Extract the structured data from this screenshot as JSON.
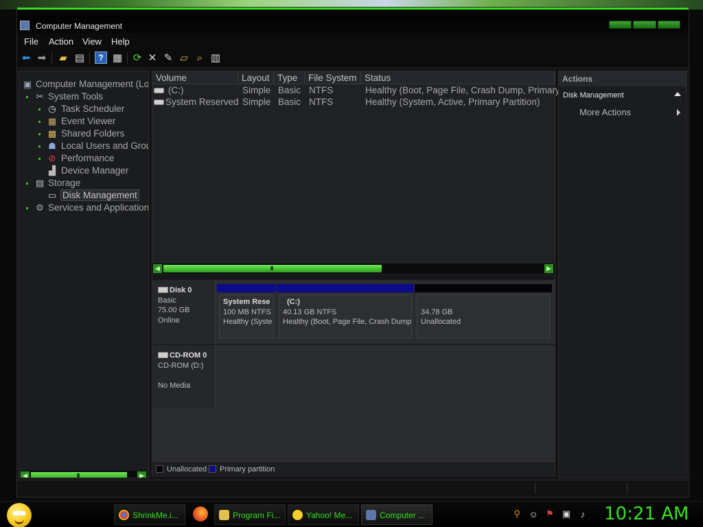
{
  "window": {
    "title": "Computer Management"
  },
  "menu": [
    "File",
    "Action",
    "View",
    "Help"
  ],
  "toolbar": {
    "icons": [
      "back-icon",
      "forward-icon",
      "up-folder-icon",
      "show-hide-tree-icon",
      "help-icon",
      "properties-icon",
      "refresh-icon",
      "delete-icon",
      "rescan-icon",
      "open-icon",
      "explore-icon",
      "properties-list-icon"
    ]
  },
  "tree": {
    "items": [
      {
        "label": "Computer Management (Loc",
        "icon": "computer-icon"
      },
      {
        "label": "System Tools",
        "icon": "tools-icon"
      },
      {
        "label": "Task Scheduler",
        "icon": "clock-icon"
      },
      {
        "label": "Event Viewer",
        "icon": "event-viewer-icon"
      },
      {
        "label": "Shared Folders",
        "icon": "shared-folder-icon"
      },
      {
        "label": "Local Users and Grou",
        "icon": "users-icon"
      },
      {
        "label": "Performance",
        "icon": "performance-icon"
      },
      {
        "label": "Device Manager",
        "icon": "device-manager-icon"
      },
      {
        "label": "Storage",
        "icon": "storage-icon"
      },
      {
        "label": "Disk Management",
        "icon": "disk-icon"
      },
      {
        "label": "Services and Application:",
        "icon": "services-icon"
      }
    ]
  },
  "volumes": {
    "columns": [
      "Volume",
      "Layout",
      "Type",
      "File System",
      "Status"
    ],
    "rows": [
      {
        "volume": "(C:)",
        "layout": "Simple",
        "type": "Basic",
        "fs": "NTFS",
        "status": "Healthy (Boot, Page File, Crash Dump, Primary"
      },
      {
        "volume": "System Reserved",
        "layout": "Simple",
        "type": "Basic",
        "fs": "NTFS",
        "status": "Healthy (System, Active, Primary Partition)"
      }
    ]
  },
  "disks": [
    {
      "name": "Disk 0",
      "kind": "Basic",
      "size": "75.00 GB",
      "state": "Online",
      "partitions": [
        {
          "title": "System Rese",
          "size": "100 MB NTFS",
          "status": "Healthy (Syste",
          "kind": "primary"
        },
        {
          "title": "(C:)",
          "size": "40.13 GB NTFS",
          "status": "Healthy (Boot, Page File, Crash Dump,",
          "kind": "primary"
        },
        {
          "title": "",
          "size": "34.78 GB",
          "status": "Unallocated",
          "kind": "unallocated"
        }
      ]
    },
    {
      "name": "CD-ROM 0",
      "kind": "CD-ROM (D:)",
      "size": "",
      "state": "No Media"
    }
  ],
  "legend": {
    "unallocated": "Unallocated",
    "primary": "Primary partition"
  },
  "actions": {
    "header": "Actions",
    "group": "Disk Management",
    "more": "More Actions"
  },
  "taskbar": {
    "tasks": [
      {
        "label": "ShrinkMe.i...",
        "icon": "chrome-icon"
      },
      {
        "label": "Program Fi...",
        "icon": "folder-icon"
      },
      {
        "label": "Yahoo! Me...",
        "icon": "yahoo-messenger-icon"
      },
      {
        "label": "Computer ...",
        "icon": "computer-management-icon"
      }
    ],
    "clock": "10:21 AM"
  },
  "colors": {
    "accent": "#38e21c",
    "primary_partition": "#0c0c8a",
    "unallocated": "#050505"
  }
}
